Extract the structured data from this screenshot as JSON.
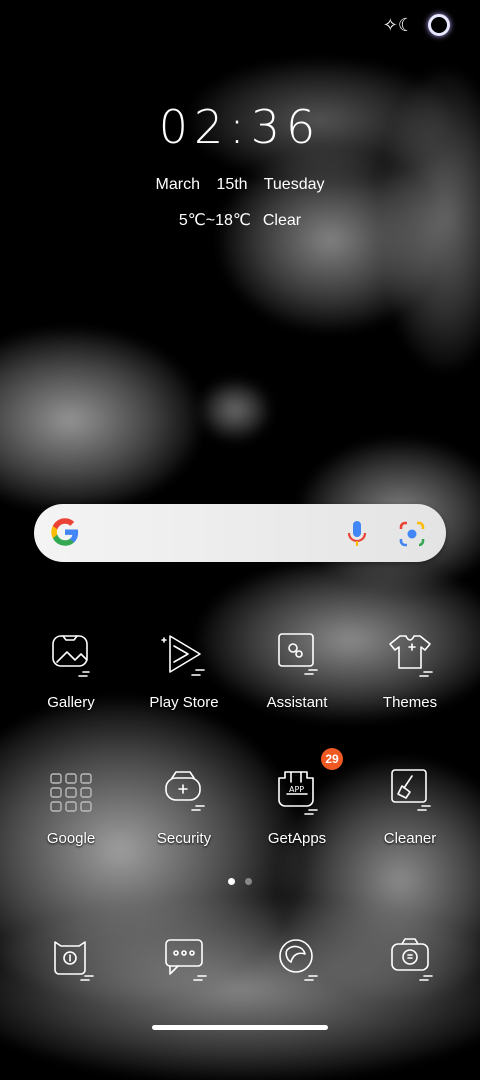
{
  "clock": {
    "time": "02:36"
  },
  "date": {
    "text": "March   15th   Tuesday"
  },
  "weather": {
    "range": "5℃~18℃",
    "condition": "Clear"
  },
  "apps_row1": [
    {
      "label": "Gallery"
    },
    {
      "label": "Play Store"
    },
    {
      "label": "Assistant"
    },
    {
      "label": "Themes"
    }
  ],
  "apps_row2": [
    {
      "label": "Google"
    },
    {
      "label": "Security"
    },
    {
      "label": "GetApps",
      "badge": "29"
    },
    {
      "label": "Cleaner"
    }
  ],
  "colors": {
    "badge": "#f05a22",
    "search_bg": "#f0f0f0"
  }
}
